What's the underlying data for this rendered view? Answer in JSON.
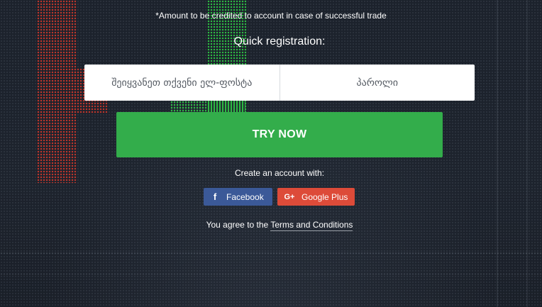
{
  "notice": "*Amount to be credited to account in case of successful trade",
  "registration": {
    "title": "Quick registration:",
    "email_placeholder": "შეიყვანეთ თქვენი ელ-ფოსტა",
    "password_placeholder": "პაროლი",
    "submit_label": "TRY NOW"
  },
  "social": {
    "label": "Create an account with:",
    "facebook": {
      "icon": "f",
      "label": "Facebook",
      "color": "#3b5998"
    },
    "google": {
      "icon": "G+",
      "label": "Google Plus",
      "color": "#dd4b39"
    }
  },
  "terms": {
    "prefix": "You agree to the",
    "link": "Terms and Conditions"
  },
  "colors": {
    "background": "#1b2029",
    "cta": "#33ad4b",
    "candle_red": "#c0362c",
    "candle_green": "#2fbf45"
  }
}
